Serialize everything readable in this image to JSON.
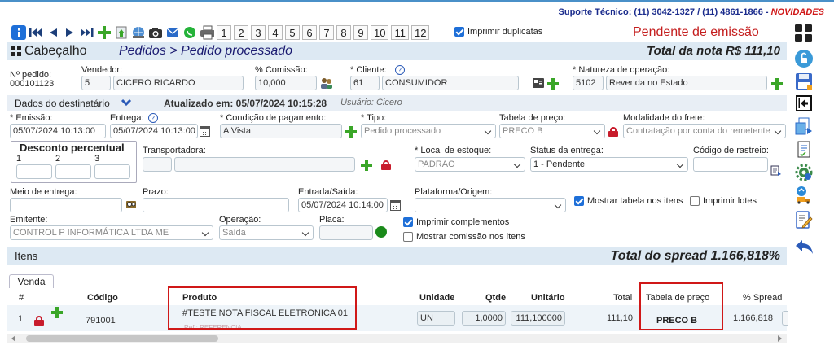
{
  "support": {
    "text": "Suporte Técnico: (11) 3042-1327 / (11) 4861-1866 - ",
    "novidades": "NOVIDADES"
  },
  "toolbar": {
    "icons": [
      "info-icon",
      "first-icon",
      "prev-icon",
      "next-icon",
      "last-icon",
      "add-icon",
      "import-icon",
      "web-icon",
      "camera-icon",
      "email-icon",
      "whatsapp-icon",
      "print-icon"
    ],
    "pages": [
      "1",
      "2",
      "3",
      "4",
      "5",
      "6",
      "7",
      "8",
      "9",
      "10",
      "11",
      "12"
    ],
    "duplicatas_label": "Imprimir duplicatas",
    "duplicatas_checked": true
  },
  "status": "Pendente de emissão",
  "header": {
    "section": "Cabeçalho",
    "breadcrumb": "Pedidos > Pedido processado",
    "total": "Total da nota R$ 111,10"
  },
  "form": {
    "pedido_label": "Nº pedido:",
    "pedido_value": "000101123",
    "vendedor_label": "Vendedor:",
    "vendedor_code": "5",
    "vendedor_name": "CICERO RICARDO",
    "comissao_label": "% Comissão:",
    "comissao_value": "10,000",
    "cliente_label": "* Cliente:",
    "cliente_code": "61",
    "cliente_name": "CONSUMIDOR",
    "natureza_label": "* Natureza de operação:",
    "natureza_code": "5102",
    "natureza_name": "Revenda no Estado"
  },
  "destinatario": {
    "label": "Dados do destinatário",
    "updated": "Atualizado em: 05/07/2024 10:15:28",
    "user": "Usuário: Cicero"
  },
  "form2": {
    "emissao_label": "* Emissão:",
    "emissao_value": "05/07/2024 10:13:00",
    "entrega_label": "Entrega:",
    "entrega_value": "05/07/2024 10:13:00",
    "condicao_label": "* Condição de pagamento:",
    "condicao_value": "A Vista",
    "tipo_label": "* Tipo:",
    "tipo_value": "Pedido processado",
    "tabela_label": "Tabela de preço:",
    "tabela_value": "PRECO B",
    "frete_label": "Modalidade do frete:",
    "frete_value": "Contratação por conta do remetente",
    "desconto_title": "Desconto percentual",
    "desconto_cols": [
      "1",
      "2",
      "3"
    ],
    "transportadora_label": "Transportadora:",
    "local_label": "* Local de estoque:",
    "local_value": "PADRAO",
    "status_entrega_label": "Status da entrega:",
    "status_entrega_value": "1 - Pendente",
    "rastreio_label": "Código de rastreio:",
    "meio_label": "Meio de entrega:",
    "prazo_label": "Prazo:",
    "entrada_label": "Entrada/Saída:",
    "entrada_value": "05/07/2024 10:14:00",
    "plataforma_label": "Plataforma/Origem:",
    "mostrar_tabela_label": "Mostrar tabela nos itens",
    "mostrar_tabela_checked": true,
    "imprimir_lotes_label": "Imprimir lotes",
    "imprimir_lotes_checked": false,
    "emitente_label": "Emitente:",
    "emitente_value": "CONTROL P INFORMÁTICA LTDA ME",
    "operacao_label": "Operação:",
    "operacao_value": "Saída",
    "placa_label": "Placa:",
    "imprimir_compl_label": "Imprimir complementos",
    "imprimir_compl_checked": true,
    "mostrar_comissao_label": "Mostrar comissão nos itens",
    "mostrar_comissao_checked": false
  },
  "itens": {
    "title": "Itens",
    "spread": "Total do spread 1.166,818%",
    "tab": "Venda",
    "columns": {
      "hash": "#",
      "codigo": "Código",
      "produto": "Produto",
      "unidade": "Unidade",
      "qtde": "Qtde",
      "unitario": "Unitário",
      "total": "Total",
      "tabela": "Tabela de preço",
      "spread": "% Spread"
    },
    "rows": [
      {
        "n": "1",
        "codigo": "791001",
        "produto": "#TESTE NOTA FISCAL ELETRONICA 01",
        "ref": "Ref.: REFERENCIA",
        "unidade": "UN",
        "qtde": "1,0000",
        "unitario": "111,100000",
        "total": "111,10",
        "tabela": "PRECO B",
        "spread": "1.166,818"
      }
    ]
  },
  "sidebar": {
    "icons": [
      "grid-icon",
      "unlock-icon",
      "save-icon",
      "exit-icon",
      "copy-icon",
      "document-icon",
      "settings-icon",
      "delivery-icon",
      "edit-icon",
      "back-icon"
    ]
  },
  "colors": {
    "accent": "#1a2b8c",
    "alert": "#d01818",
    "band": "#dde9f3",
    "add": "#3aa628"
  }
}
